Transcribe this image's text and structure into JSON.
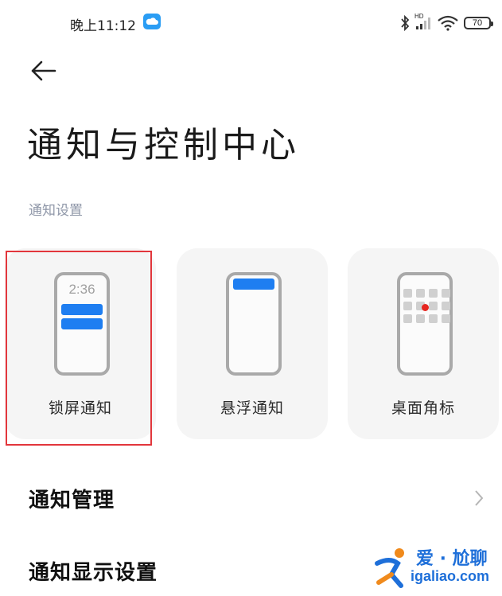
{
  "status_bar": {
    "time": "晚上11:12",
    "cloud_icon": "cloud-icon",
    "network_label": "HD",
    "battery": "70"
  },
  "header": {
    "back_icon": "arrow-left-icon",
    "title": "通知与控制中心"
  },
  "section": {
    "label": "通知设置"
  },
  "cards": [
    {
      "label": "锁屏通知",
      "preview_time": "2:36",
      "highlighted": true
    },
    {
      "label": "悬浮通知"
    },
    {
      "label": "桌面角标"
    }
  ],
  "rows": [
    {
      "label": "通知管理",
      "chevron": "chevron-right-icon"
    },
    {
      "label": "通知显示设置"
    }
  ],
  "watermark": {
    "line1": "爱 · 尬聊",
    "line2": "igaliao.com"
  },
  "colors": {
    "accent_blue": "#1e7ef1",
    "highlight_red": "#e2363c",
    "badge_red": "#e6261f",
    "card_bg": "#f5f5f5",
    "section_label": "#8f97a8"
  }
}
